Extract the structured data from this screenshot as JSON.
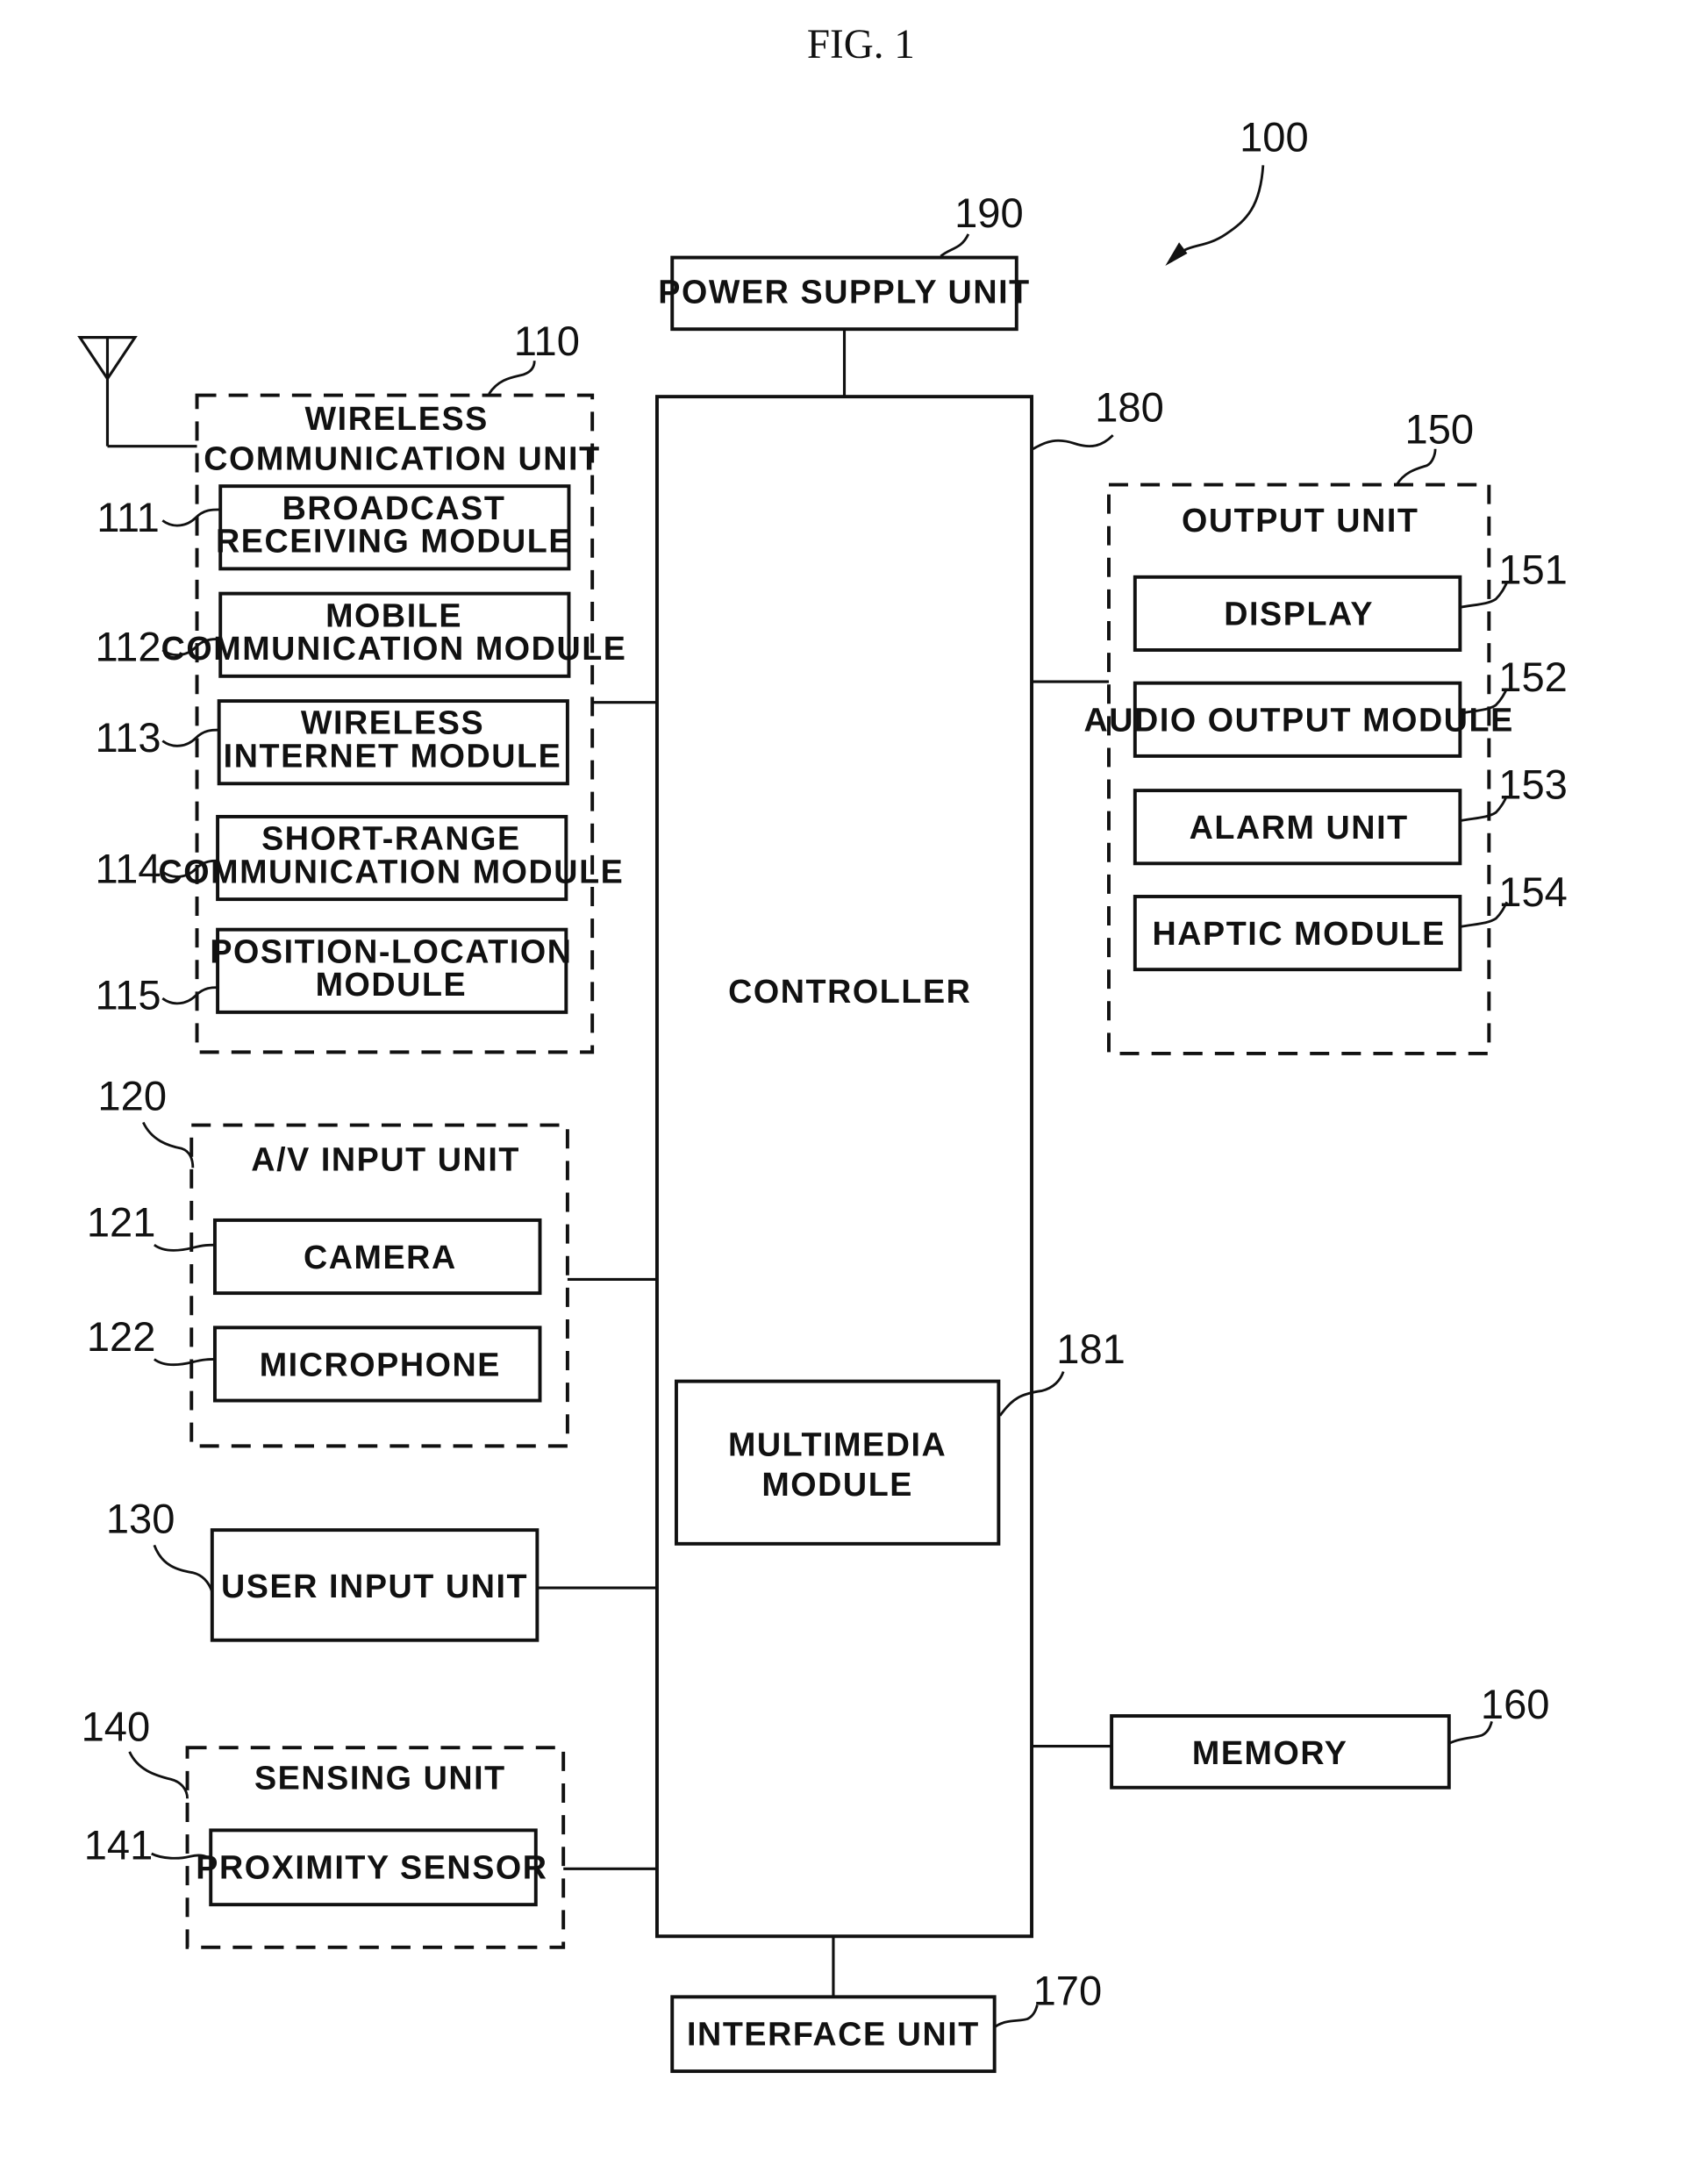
{
  "figure": {
    "title": "FIG. 1",
    "device_ref": "100"
  },
  "blocks": {
    "power_supply": {
      "label": "POWER SUPPLY UNIT",
      "ref": "190"
    },
    "controller": {
      "label": "CONTROLLER",
      "ref": "180"
    },
    "multimedia": {
      "label_lines": [
        "MULTIMEDIA",
        "MODULE"
      ],
      "ref": "181"
    },
    "wireless": {
      "label_lines": [
        "WIRELESS",
        "COMMUNICATION UNIT"
      ],
      "ref": "110",
      "modules": [
        {
          "lines": [
            "BROADCAST",
            "RECEIVING MODULE"
          ],
          "ref": "111"
        },
        {
          "lines": [
            "MOBILE",
            "COMMUNICATION MODULE"
          ],
          "ref": "112"
        },
        {
          "lines": [
            "WIRELESS",
            "INTERNET MODULE"
          ],
          "ref": "113"
        },
        {
          "lines": [
            "SHORT-RANGE",
            "COMMUNICATION MODULE"
          ],
          "ref": "114"
        },
        {
          "lines": [
            "POSITION-LOCATION",
            "MODULE"
          ],
          "ref": "115"
        }
      ]
    },
    "av_input": {
      "label": "A/V INPUT UNIT",
      "ref": "120",
      "modules": [
        {
          "label": "CAMERA",
          "ref": "121"
        },
        {
          "label": "MICROPHONE",
          "ref": "122"
        }
      ]
    },
    "user_input": {
      "label": "USER INPUT UNIT",
      "ref": "130"
    },
    "sensing": {
      "label": "SENSING UNIT",
      "ref": "140",
      "modules": [
        {
          "label": "PROXIMITY SENSOR",
          "ref": "141"
        }
      ]
    },
    "output": {
      "label": "OUTPUT UNIT",
      "ref": "150",
      "modules": [
        {
          "label": "DISPLAY",
          "ref": "151"
        },
        {
          "label": "AUDIO OUTPUT MODULE",
          "ref": "152"
        },
        {
          "label": "ALARM UNIT",
          "ref": "153"
        },
        {
          "label": "HAPTIC MODULE",
          "ref": "154"
        }
      ]
    },
    "memory": {
      "label": "MEMORY",
      "ref": "160"
    },
    "interface": {
      "label": "INTERFACE UNIT",
      "ref": "170"
    }
  }
}
